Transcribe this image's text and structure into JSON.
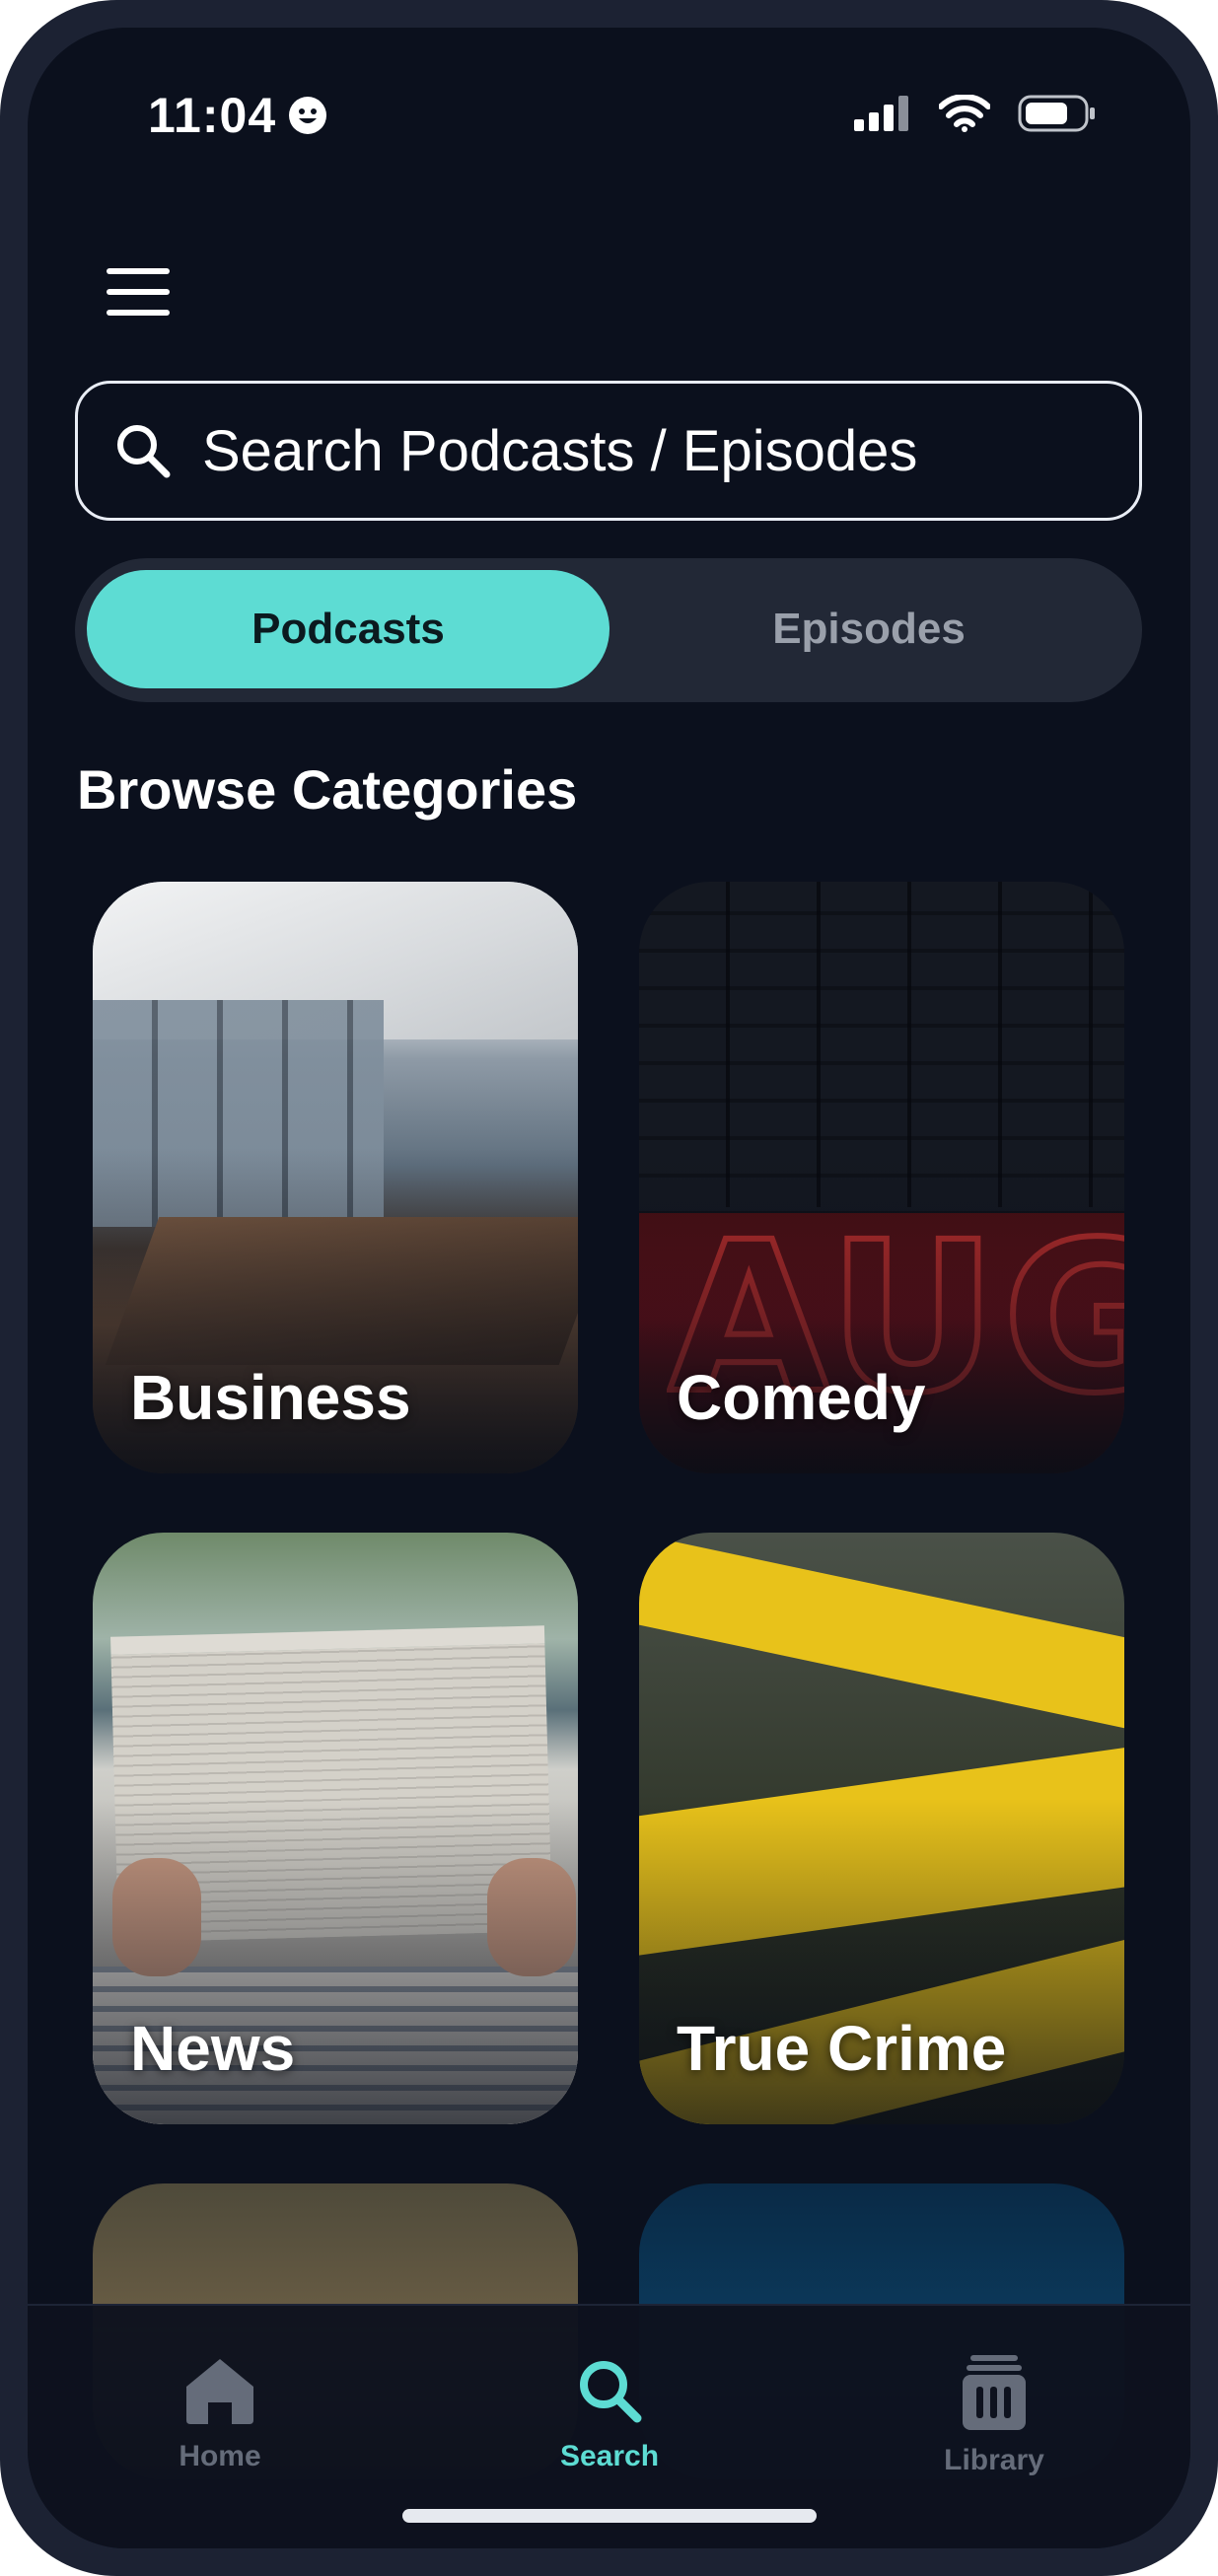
{
  "status_bar": {
    "time": "11:04",
    "time_icon": "smiley-face-icon",
    "icons": [
      "cellular-signal-icon",
      "wifi-icon",
      "battery-icon"
    ]
  },
  "header": {
    "menu_icon": "hamburger-menu-icon"
  },
  "search": {
    "icon": "search-icon",
    "placeholder": "Search Podcasts / Episodes"
  },
  "segment": {
    "selected": "Podcasts",
    "options": [
      {
        "label": "Podcasts"
      },
      {
        "label": "Episodes"
      }
    ]
  },
  "section": {
    "title": "Browse Categories"
  },
  "categories": [
    {
      "label": "Business"
    },
    {
      "label": "Comedy"
    },
    {
      "label": "News"
    },
    {
      "label": "True Crime"
    }
  ],
  "tab_bar": {
    "active": "Search",
    "tabs": [
      {
        "label": "Home",
        "icon": "home-icon"
      },
      {
        "label": "Search",
        "icon": "search-icon"
      },
      {
        "label": "Library",
        "icon": "library-icon"
      }
    ]
  },
  "colors": {
    "accent": "#5ddcd3",
    "background": "#0b101d",
    "segment_bg": "#222836",
    "inactive_tab": "#656c7a"
  }
}
